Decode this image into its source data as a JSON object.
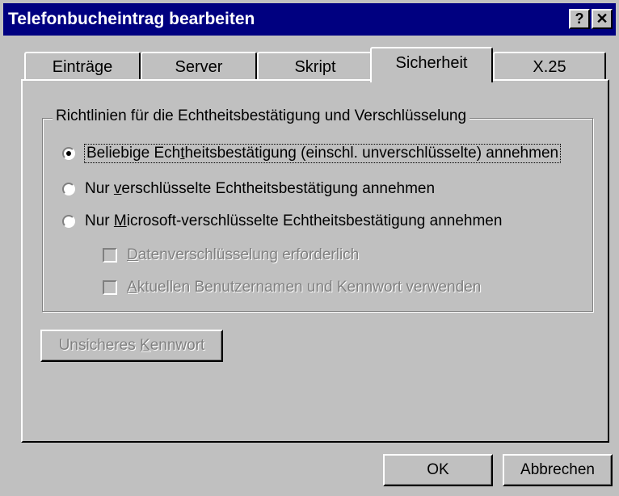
{
  "window": {
    "title": "Telefonbucheintrag bearbeiten",
    "help_glyph": "?",
    "close_glyph": "✕"
  },
  "tabs": [
    {
      "label": "Einträge",
      "active": false
    },
    {
      "label": "Server",
      "active": false
    },
    {
      "label": "Skript",
      "active": false
    },
    {
      "label": "Sicherheit",
      "active": true
    },
    {
      "label": "X.25",
      "active": false
    }
  ],
  "group": {
    "legend": "Richtlinien für die Echtheitsbestätigung und Verschlüsselung",
    "options": [
      {
        "pre": "Beliebige Ech",
        "accel": "t",
        "post": "heitsbestätigung (einschl. unverschlüsselte) annehmen",
        "checked": true
      },
      {
        "pre": "Nur ",
        "accel": "v",
        "post": "erschlüsselte Echtheitsbestätigung annehmen",
        "checked": false
      },
      {
        "pre": "Nur ",
        "accel": "M",
        "post": "icrosoft-verschlüsselte Echtheitsbestätigung annehmen",
        "checked": false
      }
    ],
    "checkboxes": [
      {
        "pre": "",
        "accel": "D",
        "post": "atenverschlüsselung erforderlich",
        "enabled": false
      },
      {
        "pre": "",
        "accel": "A",
        "post": "ktuellen Benutzernamen und Kennwort verwenden",
        "enabled": false
      }
    ]
  },
  "insecure_button": {
    "pre": "Unsicheres ",
    "accel": "K",
    "post": "ennwort",
    "enabled": false
  },
  "footer": {
    "ok": "OK",
    "cancel": "Abbrechen"
  }
}
